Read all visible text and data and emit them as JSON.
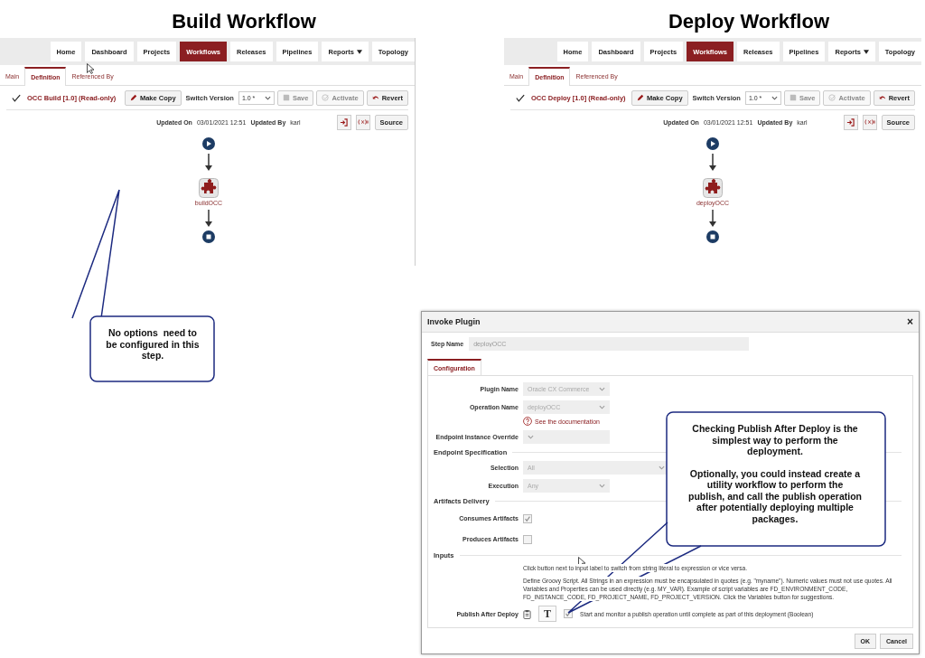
{
  "panels": [
    {
      "heading": "Build Workflow",
      "nav": [
        {
          "label": "Home",
          "selected": false,
          "dropdown": false
        },
        {
          "label": "Dashboard",
          "selected": false,
          "dropdown": false
        },
        {
          "label": "Projects",
          "selected": false,
          "dropdown": false
        },
        {
          "label": "Workflows",
          "selected": true,
          "dropdown": false
        },
        {
          "label": "Releases",
          "selected": false,
          "dropdown": false
        },
        {
          "label": "Pipelines",
          "selected": false,
          "dropdown": false
        },
        {
          "label": "Reports",
          "selected": false,
          "dropdown": true
        },
        {
          "label": "Topology",
          "selected": false,
          "dropdown": false
        }
      ],
      "tabs": [
        {
          "label": "Main",
          "selected": false
        },
        {
          "label": "Definition",
          "selected": true
        },
        {
          "label": "Referenced By",
          "selected": false
        }
      ],
      "workflow_title": "OCC Build [1.0] (Read-only)",
      "make_copy": "Make Copy",
      "switch_label": "Switch Version",
      "version": "1.0 *",
      "buttons": [
        {
          "kind": "save",
          "label": "Save",
          "disabled": true
        },
        {
          "kind": "activate",
          "label": "Activate",
          "disabled": true
        },
        {
          "kind": "revert",
          "label": "Revert",
          "disabled": false
        }
      ],
      "updated_on_label": "Updated On",
      "updated_on": "03/01/2021 12:51",
      "updated_by_label": "Updated By",
      "updated_by": "karl",
      "source_button": "Source",
      "step": "buildOCC"
    },
    {
      "heading": "Deploy Workflow",
      "nav": [
        {
          "label": "Home",
          "selected": false,
          "dropdown": false
        },
        {
          "label": "Dashboard",
          "selected": false,
          "dropdown": false
        },
        {
          "label": "Projects",
          "selected": false,
          "dropdown": false
        },
        {
          "label": "Workflows",
          "selected": true,
          "dropdown": false
        },
        {
          "label": "Releases",
          "selected": false,
          "dropdown": false
        },
        {
          "label": "Pipelines",
          "selected": false,
          "dropdown": false
        },
        {
          "label": "Reports",
          "selected": false,
          "dropdown": true
        },
        {
          "label": "Topology",
          "selected": false,
          "dropdown": false
        }
      ],
      "tabs": [
        {
          "label": "Main",
          "selected": false
        },
        {
          "label": "Definition",
          "selected": true
        },
        {
          "label": "Referenced By",
          "selected": false
        }
      ],
      "workflow_title": "OCC Deploy [1.0] (Read-only)",
      "make_copy": "Make Copy",
      "switch_label": "Switch Version",
      "version": "1.0 *",
      "buttons": [
        {
          "kind": "save",
          "label": "Save",
          "disabled": true
        },
        {
          "kind": "activate",
          "label": "Activate",
          "disabled": true
        },
        {
          "kind": "revert",
          "label": "Revert",
          "disabled": false
        }
      ],
      "updated_on_label": "Updated On",
      "updated_on": "03/01/2021 12:51",
      "updated_by_label": "Updated By",
      "updated_by": "karl",
      "source_button": "Source",
      "step": "deployOCC"
    }
  ],
  "dialog": {
    "title": "Invoke Plugin",
    "close": "×",
    "step_label": "Step Name",
    "step_value": "deployOCC",
    "tabs": [
      {
        "label": "Configuration",
        "selected": true
      }
    ],
    "rows": [
      {
        "kind": "select",
        "label": "Plugin Name",
        "value": "Oracle CX Commerce"
      },
      {
        "kind": "select",
        "label": "Operation Name",
        "value": "deployOCC"
      },
      {
        "kind": "link",
        "text": "See the documentation"
      },
      {
        "kind": "select",
        "label": "Endpoint Instance Override"
      },
      {
        "kind": "section",
        "label": "Endpoint Specification"
      },
      {
        "kind": "select-wide",
        "label": "Selection",
        "value": "All"
      },
      {
        "kind": "select",
        "label": "Execution",
        "value": "Any"
      },
      {
        "kind": "section",
        "label": "Artifacts Delivery"
      },
      {
        "kind": "checkbox",
        "label": "Consumes Artifacts",
        "checked": true
      },
      {
        "kind": "checkbox",
        "label": "Produces Artifacts",
        "checked": false
      },
      {
        "kind": "section",
        "label": "Inputs"
      },
      {
        "kind": "note",
        "text": "Click button next to input label to switch from string literal to expression or vice versa."
      },
      {
        "kind": "note",
        "text": "Define Groovy Script. All Strings in an expression must be encapsulated in quotes (e.g. \"myname\"). Numeric values must not use quotes. All Variables and Properties can be used directly (e.g. MY_VAR). Example of script variables are FD_ENVIRONMENT_CODE, FD_INSTANCE_CODE, FD_PROJECT_NAME, FD_PROJECT_VERSION. Click the Variables button for suggestions."
      },
      {
        "kind": "input",
        "label": "Publish After Deploy",
        "toggle": "T",
        "checked": true,
        "text": "Start and monitor a publish operation until complete as part of this deployment (Boolean)"
      }
    ],
    "buttons": [
      "OK",
      "Cancel"
    ]
  },
  "callouts": [
    {
      "paragraphs": [
        "No options  need to be configured in this step."
      ]
    },
    {
      "paragraphs": [
        "Checking Publish After Deploy is the simplest way to perform the deployment.",
        "Optionally, you could instead create a utility workflow to perform the publish, and call the publish operation after potentially deploying multiple packages."
      ]
    }
  ]
}
